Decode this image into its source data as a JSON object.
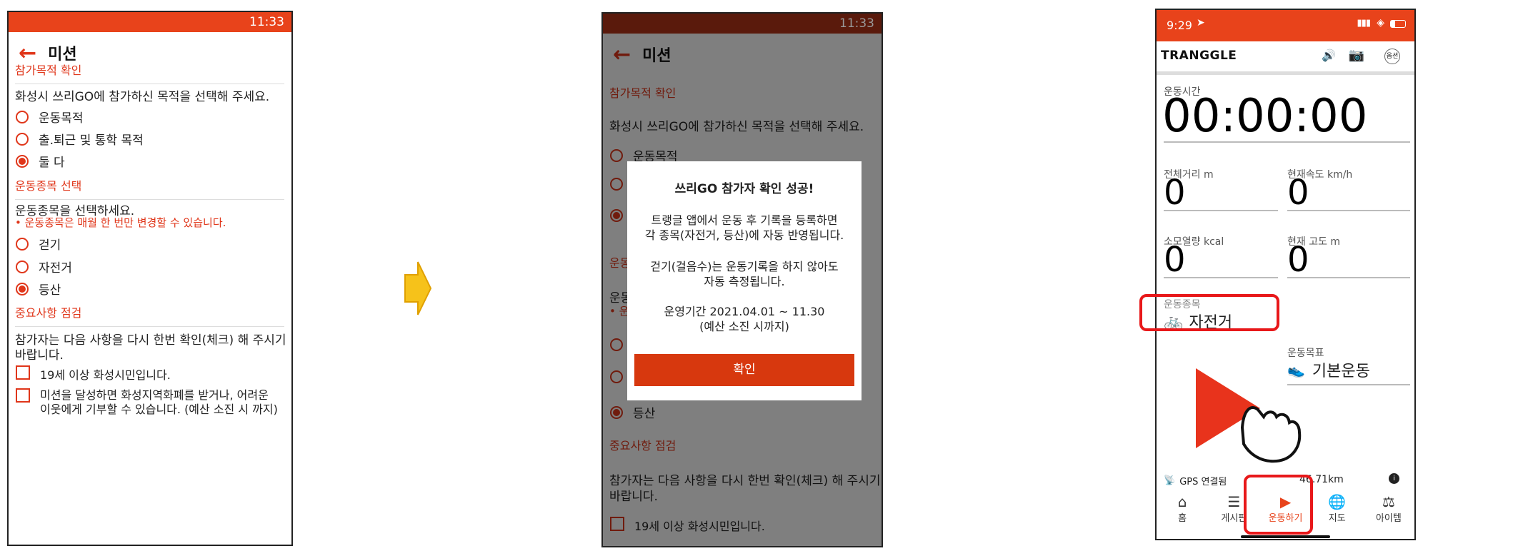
{
  "screen1": {
    "time": "11:33",
    "title": "미션",
    "sec_purpose": "참가목적 확인",
    "purpose_prompt": "화성시 쓰리GO에 참가하신 목적을 선택해 주세요.",
    "purpose_options": [
      "운동목적",
      "출.퇴근 및 통학 목적",
      "둘 다"
    ],
    "sec_sport": "운동종목 선택",
    "sport_prompt": "운동종목을 선택하세요.",
    "sport_warning": "• 운동종목은 매월 한 번만 변경할 수 있습니다.",
    "sport_options": [
      "걷기",
      "자전거",
      "등산"
    ],
    "sec_check": "중요사항 점검",
    "check_prompt_1": "참가자는 다음 사항을 다시 한번 확인(체크) 해 주시기",
    "check_prompt_2": "바랍니다.",
    "check_items": [
      {
        "l1": "19세 이상 화성시민입니다.",
        "l2": ""
      },
      {
        "l1": "미션을 달성하면 화성지역화폐를 받거나, 어려운",
        "l2": "이웃에게 기부할 수 있습니다. (예산 소진 시 까지)"
      }
    ]
  },
  "screen2": {
    "time": "11:33",
    "title": "미션",
    "bg_sec_purpose": "참가목적 확인",
    "bg_purpose_prompt": "화성시 쓰리GO에 참가하신 목적을 선택해 주세요.",
    "bg_option_hint": "운동목적",
    "bg_sec_sport_partial": "운동",
    "bg_sport_prompt_partial": "운동",
    "bg_warning_partial": "• 운",
    "bg_sport_last": "등산",
    "bg_sec_check": "중요사항 점검",
    "bg_check_prompt_1": "참가자는 다음 사항을 다시 한번 확인(체크) 해 주시기",
    "bg_check_prompt_2": "바랍니다.",
    "bg_check_item": "19세 이상 화성시민입니다.",
    "dialog": {
      "title": "쓰리GO 참가자 확인 성공!",
      "p1_l1": "트랭글 앱에서 운동 후 기록을 등록하면",
      "p1_l2": "각 종목(자전거, 등산)에 자동 반영됩니다.",
      "p2_l1": "걷기(걸음수)는 운동기록을 하지 않아도",
      "p2_l2": "자동 측정됩니다.",
      "p3_l1": "운영기간 2021.04.01 ~ 11.30",
      "p3_l2": "(예산 소진 시까지)",
      "ok": "확인"
    }
  },
  "screen3": {
    "time": "9:29",
    "brand": "TRANGGLE",
    "option_label": "옵션",
    "time_label": "운동시간",
    "time_value": "00:00:00",
    "distance_label": "전체거리 m",
    "distance_value": "0",
    "speed_label": "현재속도 km/h",
    "speed_value": "0",
    "calorie_label": "소모열량 kcal",
    "calorie_value": "0",
    "altitude_label": "현재 고도 m",
    "altitude_value": "0",
    "sport_label": "운동종목",
    "sport_value": "자전거",
    "goal_label": "운동목표",
    "goal_value": "기본운동",
    "gps_status": "GPS 연결됨",
    "gps_distance": "46.71km",
    "tabs": [
      "홈",
      "게시판",
      "운동하기",
      "지도",
      "아이템"
    ],
    "highlight_color": "#e8181a",
    "accent_color": "#e8431b"
  }
}
